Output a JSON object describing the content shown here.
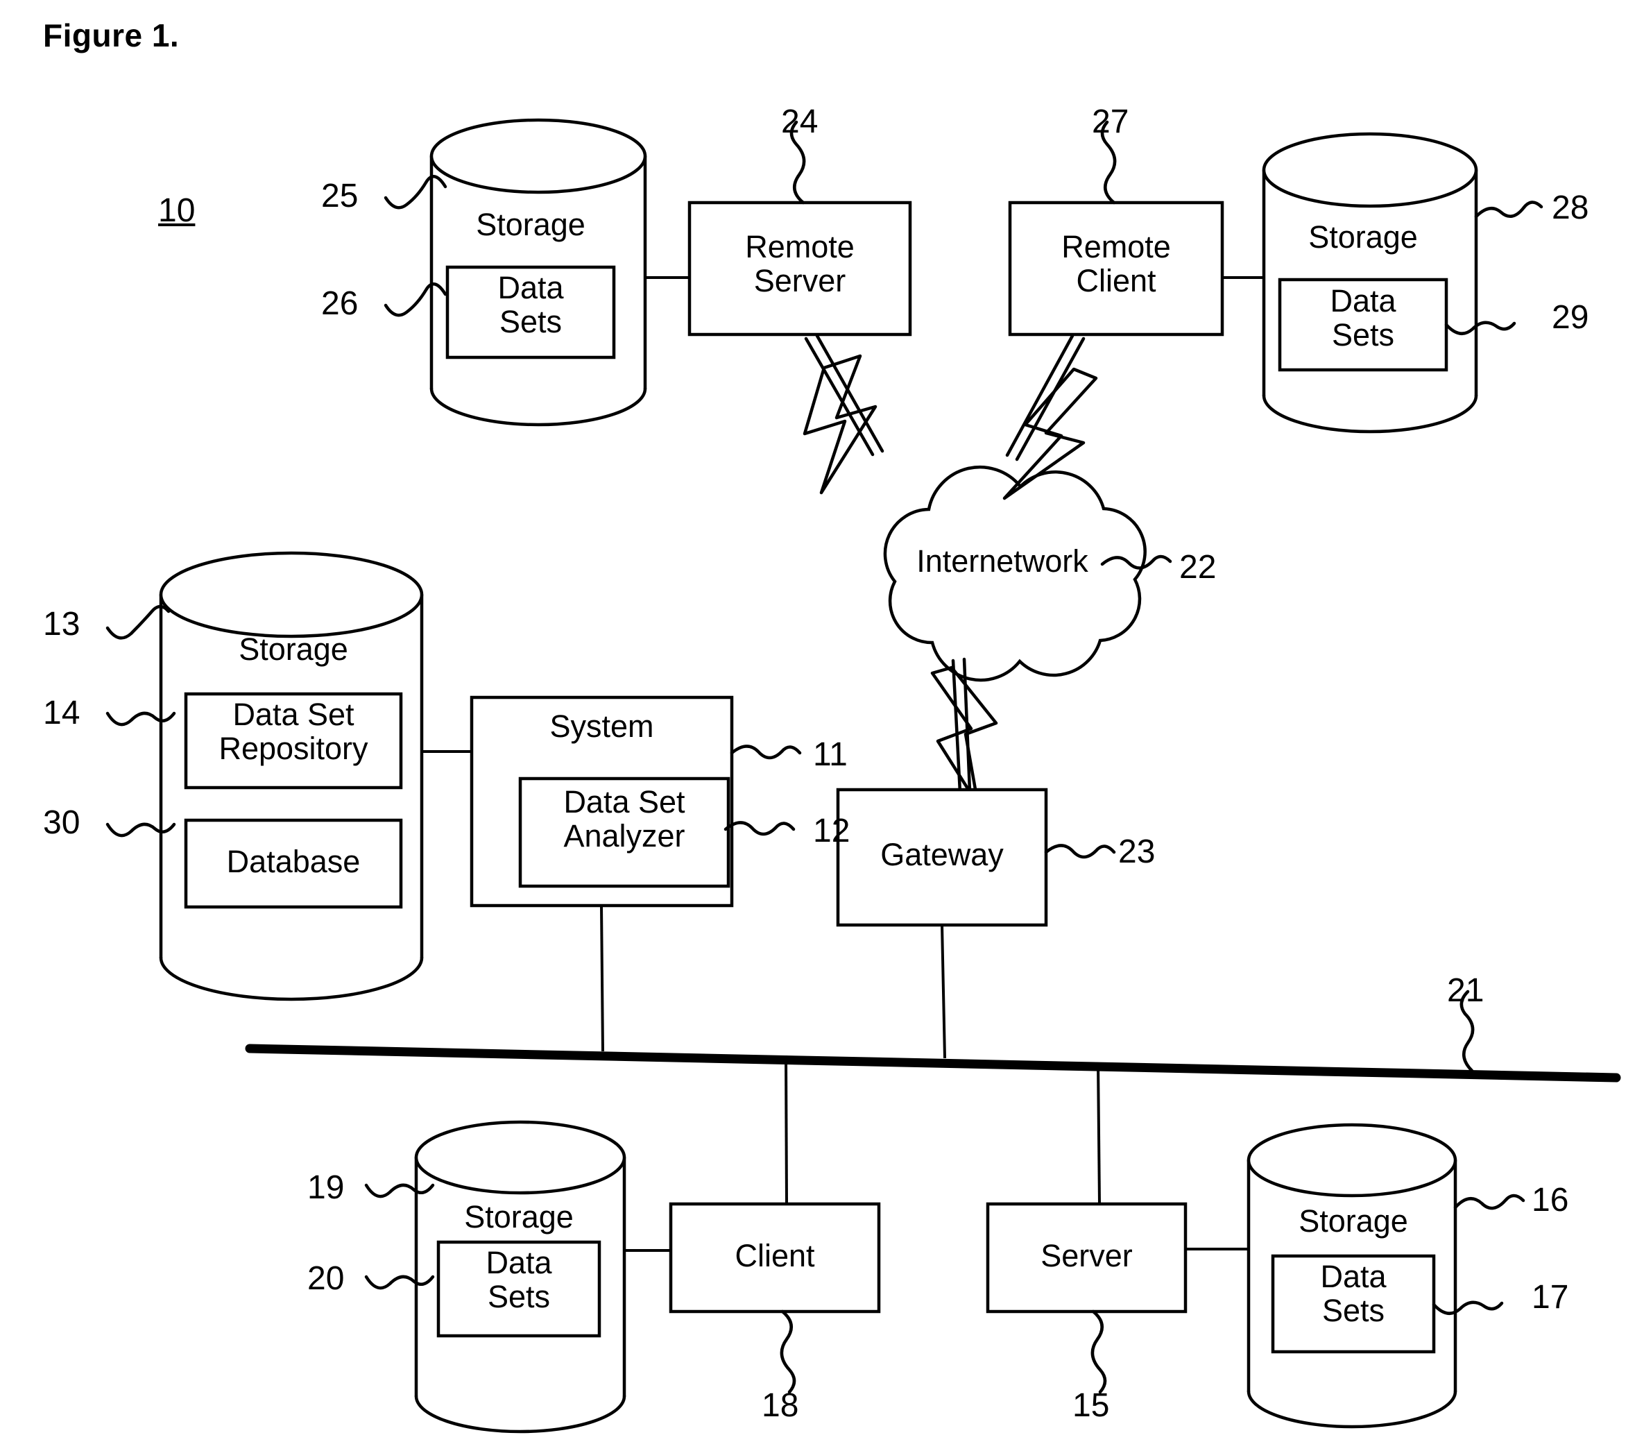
{
  "figure": {
    "title": "Figure 1.",
    "system_id": "10"
  },
  "nodes": {
    "storage_remote_server": {
      "label": "Storage",
      "inner_label": "Data\nSets",
      "ref": "25",
      "inner_ref": "26"
    },
    "remote_server": {
      "label": "Remote\nServer",
      "ref": "24"
    },
    "remote_client": {
      "label": "Remote\nClient",
      "ref": "27"
    },
    "storage_remote_client": {
      "label": "Storage",
      "inner_label": "Data\nSets",
      "ref": "28",
      "inner_ref": "29"
    },
    "internetwork": {
      "label": "Internetwork",
      "ref": "22"
    },
    "storage_main": {
      "label": "Storage",
      "repository_label": "Data Set\nRepository",
      "database_label": "Database",
      "ref": "13",
      "repository_ref": "14",
      "database_ref": "30"
    },
    "system": {
      "label": "System",
      "analyzer_label": "Data Set\nAnalyzer",
      "ref": "11",
      "analyzer_ref": "12"
    },
    "gateway": {
      "label": "Gateway",
      "ref": "23"
    },
    "network_bus": {
      "ref": "21"
    },
    "storage_client": {
      "label": "Storage",
      "inner_label": "Data\nSets",
      "ref": "19",
      "inner_ref": "20"
    },
    "client": {
      "label": "Client",
      "ref": "18"
    },
    "server": {
      "label": "Server",
      "ref": "15"
    },
    "storage_server": {
      "label": "Storage",
      "inner_label": "Data\nSets",
      "ref": "16",
      "inner_ref": "17"
    }
  },
  "colors": {
    "ink": "#000000",
    "paper": "#ffffff"
  }
}
